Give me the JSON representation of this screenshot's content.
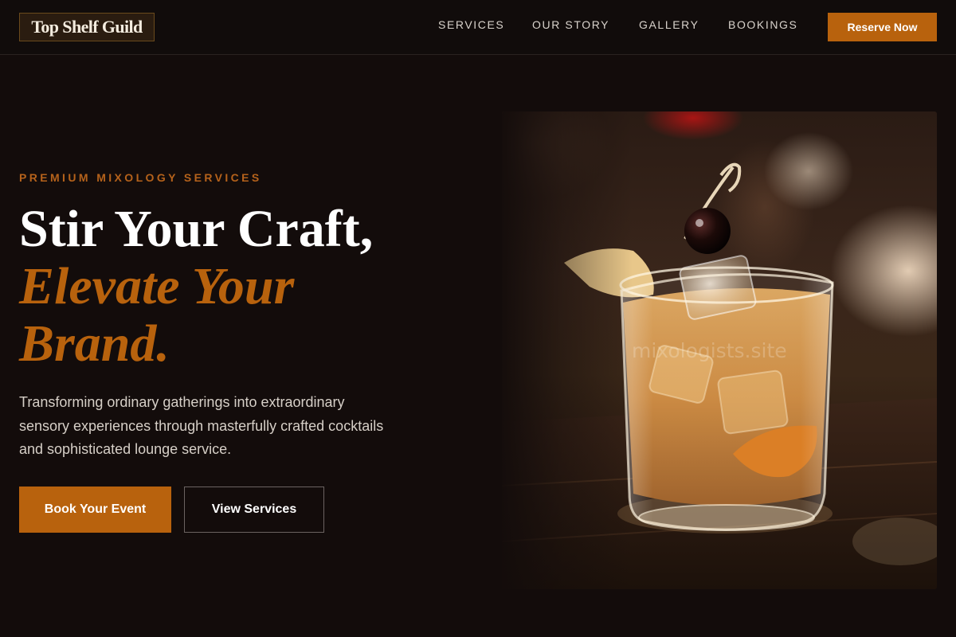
{
  "header": {
    "logo_text": "Top Shelf Guild",
    "nav": {
      "services": "SERVICES",
      "story": "OUR STORY",
      "gallery": "GALLERY",
      "bookings": "BOOKINGS"
    },
    "cta_label": "Reserve Now"
  },
  "hero": {
    "eyebrow": "PREMIUM MIXOLOGY SERVICES",
    "headline_line1": "Stir Your Craft,",
    "headline_line2": "Elevate Your",
    "headline_line3": "Brand.",
    "description": "Transforming ordinary gatherings into extraordinary sensory experiences through masterfully crafted cocktails and sophisticated lounge service.",
    "primary_button": "Book Your Event",
    "secondary_button": "View Services",
    "image_watermark": "mixologists.site"
  },
  "colors": {
    "accent": "#b8620d",
    "background": "#130c0b",
    "header_background": "#110c0b"
  }
}
